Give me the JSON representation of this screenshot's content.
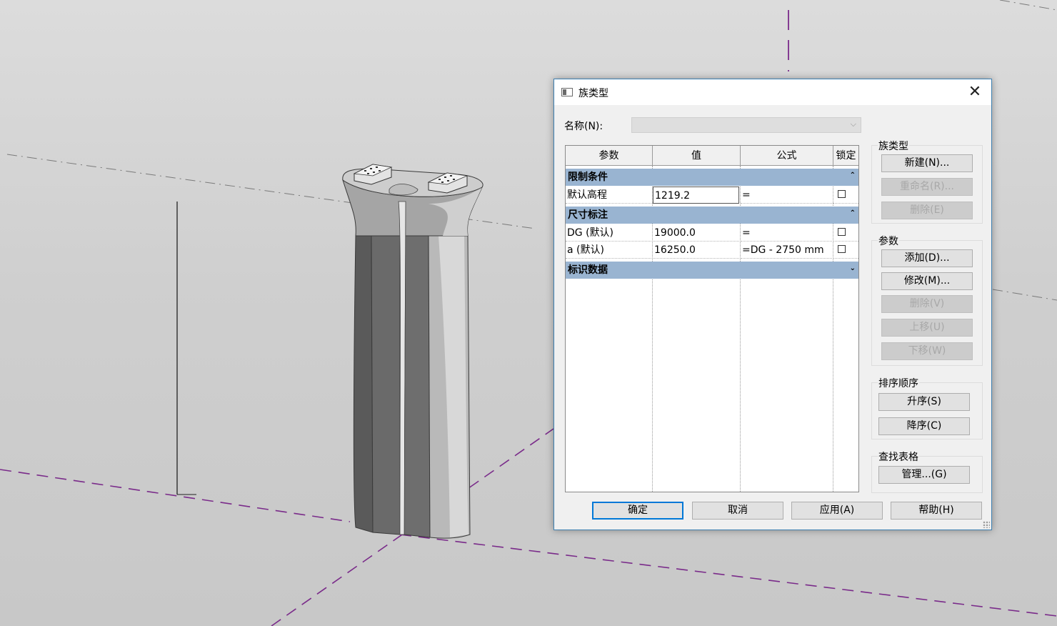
{
  "dialog": {
    "title": "族类型",
    "name_label": "名称(N):",
    "name_value": ""
  },
  "table": {
    "headers": {
      "param": "参数",
      "value": "值",
      "formula": "公式",
      "lock": "锁定"
    },
    "groups": [
      {
        "title": "限制条件",
        "chevron": "up-chevron-icon",
        "rows": [
          {
            "param": "默认高程",
            "value": "1219.2",
            "formula": "=",
            "locked": false
          }
        ]
      },
      {
        "title": "尺寸标注",
        "chevron": "up-chevron-icon",
        "rows": [
          {
            "param": "DG (默认)",
            "value": "19000.0",
            "formula": "=",
            "locked": false
          },
          {
            "param": "a (默认)",
            "value": "16250.0",
            "formula": "=DG - 2750 mm",
            "locked": false
          }
        ]
      },
      {
        "title": "标识数据",
        "chevron": "down-chevron-icon",
        "rows": []
      }
    ]
  },
  "family_types": {
    "label": "族类型",
    "new": "新建(N)...",
    "rename": "重命名(R)...",
    "delete": "删除(E)"
  },
  "parameters": {
    "label": "参数",
    "add": "添加(D)...",
    "modify": "修改(M)...",
    "delete": "删除(V)",
    "move_up": "上移(U)",
    "move_down": "下移(W)"
  },
  "sort": {
    "label": "排序顺序",
    "ascending": "升序(S)",
    "descending": "降序(C)"
  },
  "lookup": {
    "label": "查找表格",
    "manage": "管理...(G)"
  },
  "footer": {
    "ok": "确定",
    "cancel": "取消",
    "apply": "应用(A)",
    "help": "帮助(H)"
  },
  "colors": {
    "group_header": "#99b4d1",
    "dialog_border": "#3c7fb1",
    "ref_plane": "#7a2b8a",
    "default_button_border": "#0078d7"
  }
}
